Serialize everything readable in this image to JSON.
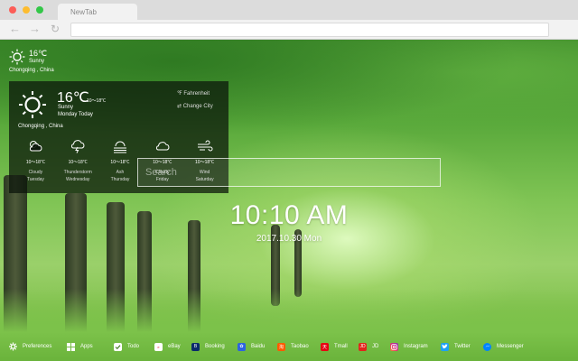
{
  "browser": {
    "tab_title": "NewTab",
    "nav": {
      "back": "←",
      "forward": "→",
      "reload": "↻"
    }
  },
  "weather_mini": {
    "temp": "16℃",
    "condition": "Sunny",
    "location": "Chongqing , China"
  },
  "weather_panel": {
    "temp": "16℃",
    "range": "10～18℃",
    "condition": "Sunny",
    "day": "Monday Today",
    "location": "Chongqing , China",
    "unit_toggle": "℉ Fahrenheit",
    "change_city": "⇄ Change City",
    "forecast": [
      {
        "icon": "cloudy-sun-icon",
        "range": "10～18℃",
        "condition": "Cloudy",
        "day": "Tuesday"
      },
      {
        "icon": "thunderstorm-icon",
        "range": "10～18℃",
        "condition": "Thunderstorm",
        "day": "Wednesday"
      },
      {
        "icon": "ash-icon",
        "range": "10～18℃",
        "condition": "Ash",
        "day": "Thursday"
      },
      {
        "icon": "cloud-icon",
        "range": "10～18℃",
        "condition": "Cloudy",
        "day": "Friday"
      },
      {
        "icon": "wind-icon",
        "range": "10～18℃",
        "condition": "Wind",
        "day": "Saturday"
      }
    ]
  },
  "search": {
    "placeholder": "Search"
  },
  "clock": {
    "time": "10:10 AM",
    "date": "2017.10.30 Mon"
  },
  "bottom_bar": [
    {
      "label": "Preferences",
      "icon": "gear-icon",
      "color": "transparent"
    },
    {
      "label": "Apps",
      "icon": "grid-icon",
      "color": "transparent"
    },
    {
      "label": "Todo",
      "icon": "checkbox-icon",
      "color": "#ffffff"
    },
    {
      "label": "eBay",
      "icon": "ebay-icon",
      "color": "#ffffff"
    },
    {
      "label": "Booking",
      "icon": "booking-icon",
      "color": "#0a2a6b"
    },
    {
      "label": "Baidu",
      "icon": "baidu-icon",
      "color": "#2d63e0"
    },
    {
      "label": "Taobao",
      "icon": "taobao-icon",
      "color": "#ff5a00"
    },
    {
      "label": "Tmall",
      "icon": "tmall-icon",
      "color": "#e60012"
    },
    {
      "label": "JD",
      "icon": "jd-icon",
      "color": "#e1251b"
    },
    {
      "label": "Instagram",
      "icon": "instagram-icon",
      "color": "#c13584"
    },
    {
      "label": "Twitter",
      "icon": "twitter-icon",
      "color": "#1da1f2"
    },
    {
      "label": "Messenger",
      "icon": "messenger-icon",
      "color": "#0084ff"
    }
  ]
}
